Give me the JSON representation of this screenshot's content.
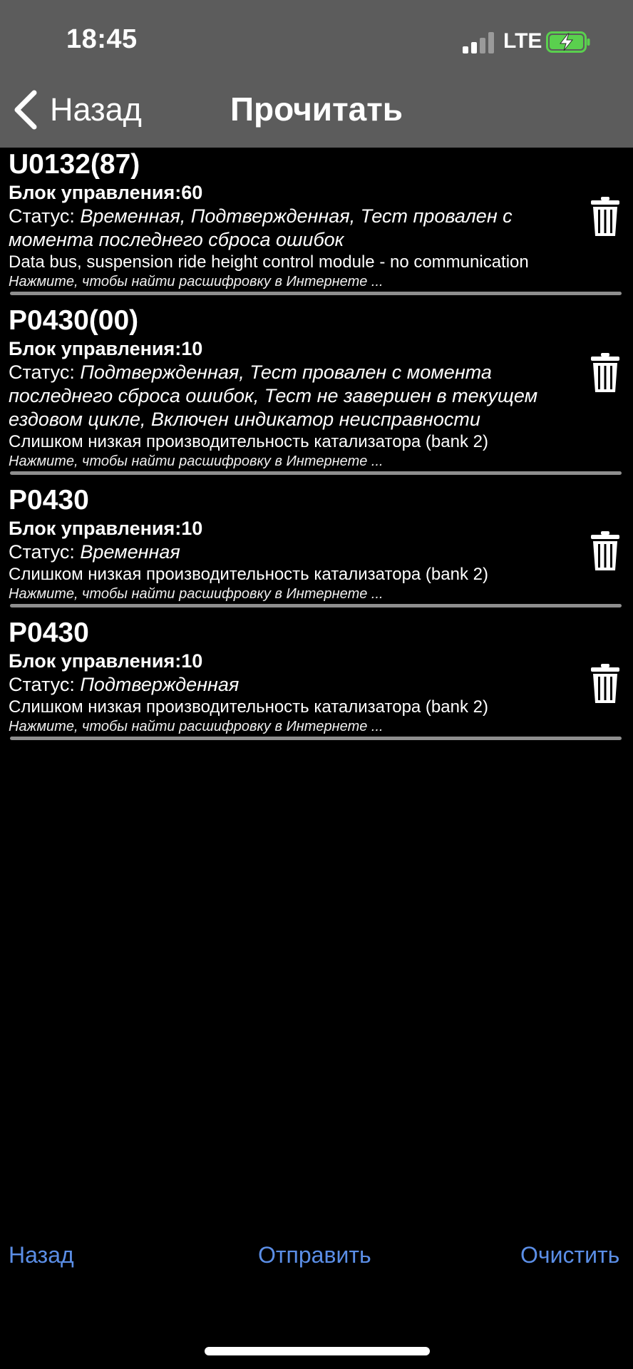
{
  "status_bar": {
    "time": "18:45",
    "network": "LTE",
    "icons": [
      "signal-icon",
      "battery-charging-icon"
    ]
  },
  "nav": {
    "back_label": "Назад",
    "title": "Прочитать"
  },
  "errors": [
    {
      "code": "U0132(87)",
      "block": "Блок управления:60",
      "status_prefix": "Статус: ",
      "status_value": "Временная, Подтвержденная, Тест провален с момента последнего сброса ошибок",
      "description": "Data bus, suspension ride height control module - no communication",
      "hint": "Нажмите, чтобы найти расшифровку в Интернете ..."
    },
    {
      "code": "P0430(00)",
      "block": "Блок управления:10",
      "status_prefix": "Статус: ",
      "status_value": "Подтвержденная, Тест провален с момента последнего сброса ошибок, Тест не завершен в текущем ездовом цикле, Включен индикатор неисправности",
      "description": "Слишком низкая производительность катализатора (bank 2)",
      "hint": "Нажмите, чтобы найти расшифровку в Интернете ..."
    },
    {
      "code": "P0430",
      "block": "Блок управления:10",
      "status_prefix": "Статус: ",
      "status_value": "Временная",
      "description": "Слишком низкая производительность катализатора (bank 2)",
      "hint": "Нажмите, чтобы найти расшифровку в Интернете ..."
    },
    {
      "code": "P0430",
      "block": "Блок управления:10",
      "status_prefix": "Статус: ",
      "status_value": "Подтвержденная",
      "description": "Слишком низкая производительность катализатора (bank 2)",
      "hint": "Нажмите, чтобы найти расшифровку в Интернете ..."
    }
  ],
  "toolbar": {
    "back_label": "Назад",
    "send_label": "Отправить",
    "clear_label": "Очистить"
  },
  "colors": {
    "header_bg": "#5c5c5c",
    "accent": "#5b8ee6",
    "battery_green": "#5ad04e",
    "separator": "#8e8e8e"
  }
}
